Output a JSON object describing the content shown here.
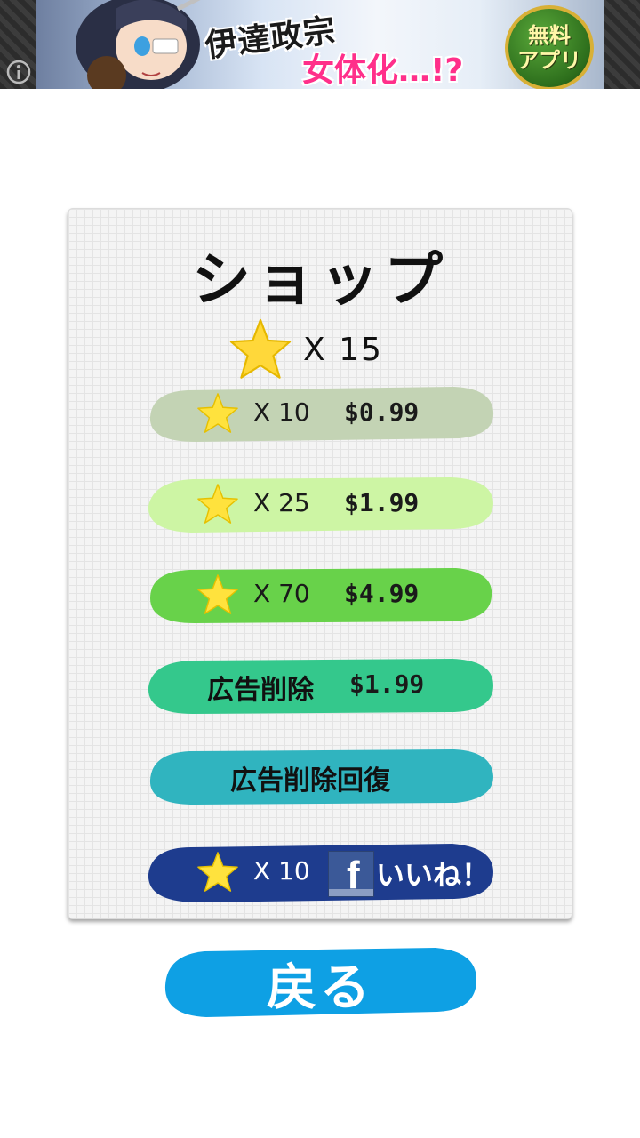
{
  "ad_banner": {
    "line1": "伊達政宗",
    "line2": "女体化…!?",
    "badge_line1": "無料",
    "badge_line2": "アプリ"
  },
  "shop": {
    "title": "ショップ",
    "star_balance": "X 15",
    "items": [
      {
        "qty": "X 10",
        "price": "$0.99",
        "color": "#c3d3b4"
      },
      {
        "qty": "X 25",
        "price": "$1.99",
        "color": "#cdf5a4"
      },
      {
        "qty": "X 70",
        "price": "$4.99",
        "color": "#68d24a"
      },
      {
        "label": "広告削除",
        "price": "$1.99",
        "color": "#34c88c"
      },
      {
        "label": "広告削除回復",
        "color": "#30b4bf"
      },
      {
        "qty": "X 10",
        "like_label": "いいね！",
        "color": "#1e3c8e"
      }
    ]
  },
  "back_button": {
    "label": "戻る",
    "color": "#0ea0e4"
  },
  "icons": {
    "star": "star-icon",
    "info": "info-icon",
    "facebook": "facebook-icon"
  }
}
